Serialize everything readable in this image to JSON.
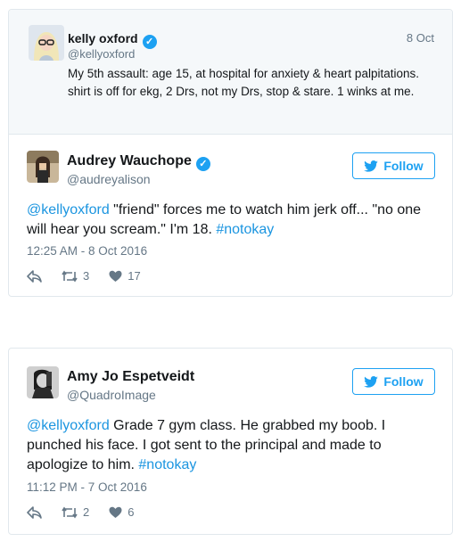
{
  "quoted_tweet": {
    "name": "kelly oxford",
    "handle": "@kellyoxford",
    "date": "8 Oct",
    "text": "My 5th assault: age 15, at hospital for anxiety & heart palpitations. shirt is off for ekg, 2 Drs, not my Drs, stop & stare. 1 winks at me.",
    "verified_icon": "verified-badge-icon"
  },
  "reply_1": {
    "name": "Audrey Wauchope",
    "handle": "@audreyalison",
    "follow_label": "Follow",
    "mention": "@kellyoxford",
    "text": " \"friend\" forces me to watch him jerk off... \"no one will hear you scream.\" I'm 18. ",
    "hashtag": "#notokay",
    "timestamp": "12:25 AM - 8 Oct 2016",
    "retweets": "3",
    "likes": "17"
  },
  "reply_2": {
    "name": "Amy Jo Espetveidt",
    "handle": "@QuadroImage",
    "follow_label": "Follow",
    "mention": "@kellyoxford",
    "text": " Grade 7 gym class. He grabbed my boob. I punched his face. I got sent to the principal and made to apologize to him. ",
    "hashtag": "#notokay",
    "timestamp": "11:12 PM - 7 Oct 2016",
    "retweets": "2",
    "likes": "6"
  },
  "colors": {
    "link": "#1b95e0",
    "verified": "#1da1f2",
    "muted": "#657786",
    "quoted_bg": "#f5f8fa",
    "border": "#e1e8ed"
  }
}
